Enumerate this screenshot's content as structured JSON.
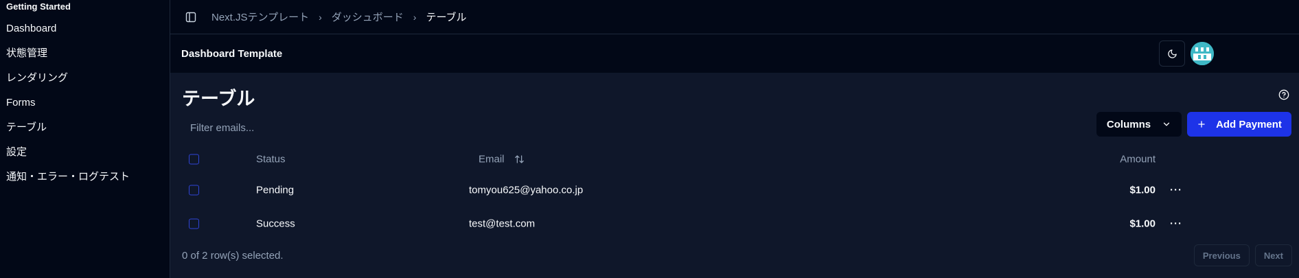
{
  "sidebar": {
    "heading": "Getting Started",
    "items": [
      {
        "label": "Dashboard"
      },
      {
        "label": "状態管理"
      },
      {
        "label": "レンダリング"
      },
      {
        "label": "Forms"
      },
      {
        "label": "テーブル"
      },
      {
        "label": "設定"
      },
      {
        "label": "通知・エラー・ログテスト"
      }
    ]
  },
  "topbar": {
    "breadcrumb": [
      "Next.JSテンプレート",
      "ダッシュボード",
      "テーブル"
    ]
  },
  "header": {
    "title": "Dashboard Template"
  },
  "page": {
    "title": "テーブル",
    "filter_placeholder": "Filter emails...",
    "columns_button": "Columns",
    "add_button": "Add Payment"
  },
  "table": {
    "headers": {
      "status": "Status",
      "email": "Email",
      "amount": "Amount"
    },
    "rows": [
      {
        "status": "Pending",
        "email": "tomyou625@yahoo.co.jp",
        "amount": "$1.00"
      },
      {
        "status": "Success",
        "email": "test@test.com",
        "amount": "$1.00"
      }
    ],
    "menu_glyph": "···"
  },
  "footer": {
    "selection_text": "0 of 2 row(s) selected.",
    "previous": "Previous",
    "next": "Next"
  },
  "colors": {
    "background": "#020817",
    "content_bg": "#0f172a",
    "accent": "#1d33e8",
    "muted_text": "#94a3b8"
  },
  "icons": [
    "sidebar-toggle-icon",
    "chevron-right-icon",
    "moon-icon",
    "help-circle-icon",
    "chevron-down-icon",
    "plus-icon",
    "sort-arrows-icon",
    "more-horizontal-icon"
  ]
}
